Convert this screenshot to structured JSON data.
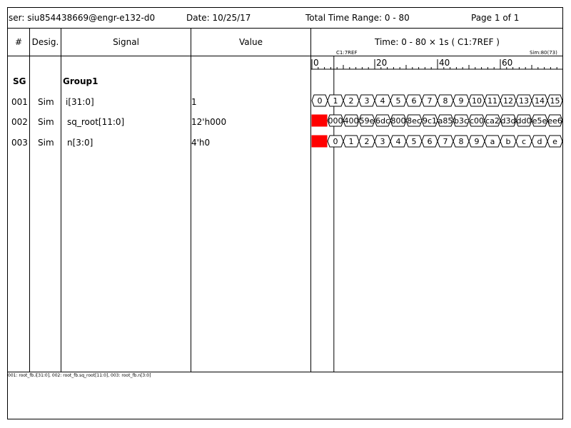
{
  "header": {
    "user": "ser: siu854438669@engr-e132-d0",
    "date": "Date: 10/25/17",
    "time_range": "Total Time Range: 0 - 80",
    "page": "Page 1 of 1"
  },
  "columns": {
    "num": "#",
    "desig": "Desig.",
    "signal": "Signal",
    "value": "Value",
    "time": "Time: 0 - 80 × 1s ( C1:7REF )"
  },
  "ruler": {
    "cursor_label": "C1:7REF",
    "sim_label": "Sim:80(73)",
    "tick_labels": [
      "0",
      "20",
      "40",
      "60"
    ]
  },
  "group": {
    "id": "SG",
    "name": "Group1"
  },
  "signals": [
    {
      "num": "001",
      "desig": "Sim",
      "name": "i[31:0]",
      "value": "1",
      "segments": [
        "0",
        "1",
        "2",
        "3",
        "4",
        "5",
        "6",
        "7",
        "8",
        "9",
        "10",
        "11",
        "12",
        "13",
        "14",
        "15"
      ],
      "first_red": false
    },
    {
      "num": "002",
      "desig": "Sim",
      "name": "sq_root[11:0]",
      "value": "12'h000",
      "segments": [
        "",
        "000",
        "400",
        "59e",
        "6dc",
        "800",
        "8ec",
        "9c1",
        "a85",
        "b3c",
        "c00",
        "ca2",
        "d3d",
        "dd0",
        "e5e",
        "ee6"
      ],
      "first_red": true
    },
    {
      "num": "003",
      "desig": "Sim",
      "name": "n[3:0]",
      "value": "4'h0",
      "segments": [
        "",
        "0",
        "1",
        "2",
        "3",
        "4",
        "5",
        "6",
        "7",
        "8",
        "9",
        "a",
        "b",
        "c",
        "d",
        "e"
      ],
      "first_red": true
    }
  ],
  "footer": {
    "legend": "001: root_fb.i[31:0], 002: root_fb.sq_root[11:0], 003: root_fb.n[3:0]"
  },
  "colors": {
    "unknown": "#ff0000",
    "line": "#000000"
  }
}
